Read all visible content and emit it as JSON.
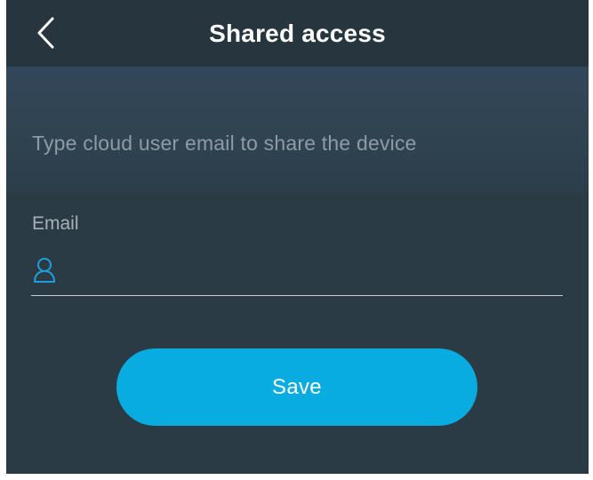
{
  "header": {
    "title": "Shared access",
    "back_icon": "chevron-left-icon"
  },
  "info": {
    "text": "Type cloud user email to share the device"
  },
  "email": {
    "label": "Email",
    "icon": "user-icon",
    "value": "",
    "placeholder": ""
  },
  "actions": {
    "save_label": "Save"
  },
  "colors": {
    "background": "#2a3a45",
    "header": "#27353f",
    "info_band": "#33475a",
    "accent": "#09ace0",
    "icon": "#1e9fdc"
  }
}
